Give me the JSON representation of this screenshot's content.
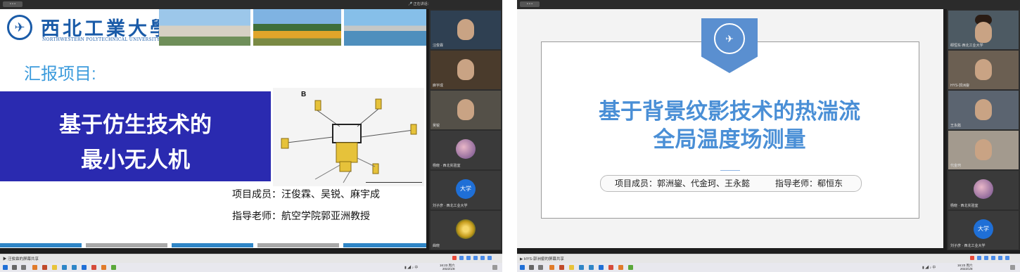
{
  "left": {
    "top_bar_label": "正在讲话：",
    "university": {
      "name_cn": "西北工業大學",
      "name_en": "NORTHWESTERN POLYTECHNICAL UNIVERSITY"
    },
    "report_label": "汇报项目:",
    "project_title": [
      "基于仿生技术的",
      "最小无人机"
    ],
    "figure_label": "B",
    "members": "项目成员：汪俊霖、吴锐、麻宇成",
    "advisor": "指导老师：航空学院郭亚洲教授",
    "share_label": "汪俊霖的屏幕共享",
    "tiles": [
      {
        "kind": "video",
        "label": "汪俊霖"
      },
      {
        "kind": "video",
        "label": "麻宇成"
      },
      {
        "kind": "video",
        "label": "吴锐"
      },
      {
        "kind": "avatar-image",
        "label": "杨晓 · 西北实验室"
      },
      {
        "kind": "avatar-text",
        "avatar_text": "大学",
        "label": "刘子彦 · 西北工业大学"
      },
      {
        "kind": "avatar-flower",
        "label": "曲晓"
      }
    ],
    "clock": {
      "time": "16:23",
      "day": "周六",
      "date": "2022/1/8"
    }
  },
  "right": {
    "project_title": [
      "基于背景纹影技术的热湍流",
      "全局温度场测量"
    ],
    "members": "项目成员：郭洲鋆、代金珂、王永懿",
    "advisor": "指导老师：郗恒东",
    "share_label": "HYS-郭洲鋆的屏幕共享",
    "tiles": [
      {
        "kind": "video",
        "label": "郗恒东·西北工业大学"
      },
      {
        "kind": "video",
        "label": "HYS-郭洲鋆"
      },
      {
        "kind": "video",
        "label": "王永懿"
      },
      {
        "kind": "video",
        "label": "代金珂"
      },
      {
        "kind": "avatar-image",
        "label": "杨晓 · 西北实验室"
      },
      {
        "kind": "avatar-text",
        "avatar_text": "大学",
        "label": "刘子彦 · 西北工业大学"
      }
    ],
    "clock": {
      "time": "16:23",
      "day": "周六",
      "date": "2022/1/8"
    }
  },
  "colors": {
    "uni_blue": "#1a5ba8",
    "project_box": "#2a2ab0",
    "title_blue": "#4a8fd6",
    "report_label": "#3c9bdc"
  },
  "icons": [
    "windows-start-icon",
    "search-icon",
    "browser-icon",
    "meeting-app-icon",
    "mic-icon",
    "camera-icon",
    "share-screen-icon",
    "volume-icon",
    "network-icon"
  ]
}
